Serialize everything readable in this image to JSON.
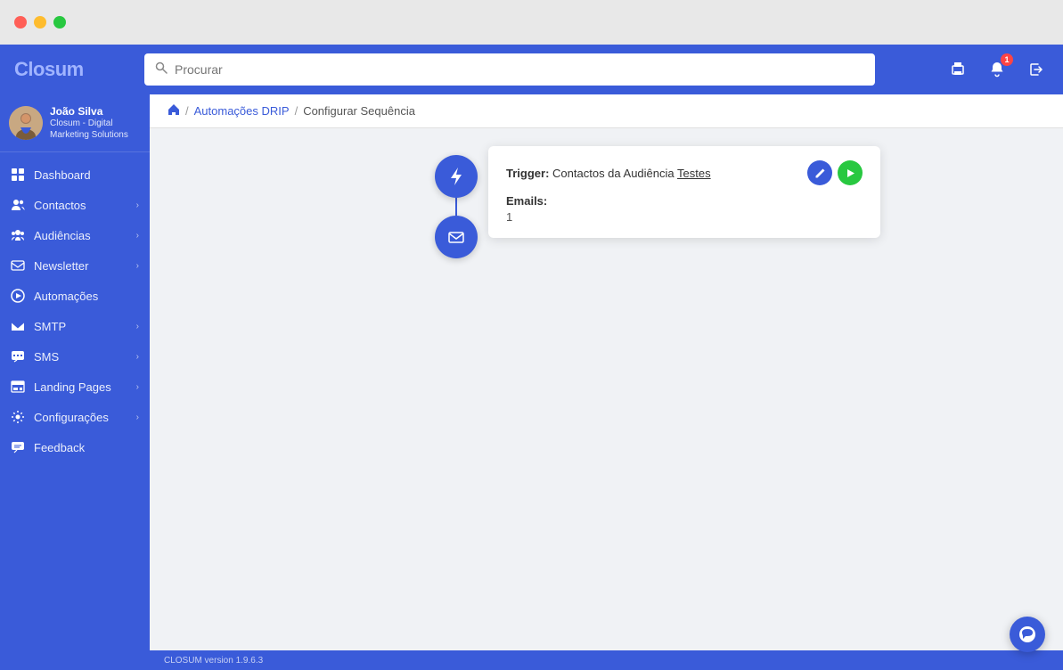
{
  "window": {
    "dots": [
      "red",
      "yellow",
      "green"
    ]
  },
  "topnav": {
    "logo_part1": "Cl",
    "logo_o": "o",
    "logo_part2": "sum",
    "search_placeholder": "Procurar",
    "notification_badge": "1"
  },
  "user": {
    "name": "João Silva",
    "company": "Closum - Digital Marketing Solutions"
  },
  "sidebar": {
    "items": [
      {
        "label": "Dashboard",
        "icon": "dashboard-icon",
        "has_chevron": false
      },
      {
        "label": "Contactos",
        "icon": "contacts-icon",
        "has_chevron": true
      },
      {
        "label": "Audiências",
        "icon": "audiences-icon",
        "has_chevron": true
      },
      {
        "label": "Newsletter",
        "icon": "newsletter-icon",
        "has_chevron": true
      },
      {
        "label": "Automações",
        "icon": "automacoes-icon",
        "has_chevron": false
      },
      {
        "label": "SMTP",
        "icon": "smtp-icon",
        "has_chevron": true
      },
      {
        "label": "SMS",
        "icon": "sms-icon",
        "has_chevron": true
      },
      {
        "label": "Landing Pages",
        "icon": "landing-pages-icon",
        "has_chevron": true
      },
      {
        "label": "Configurações",
        "icon": "config-icon",
        "has_chevron": true
      },
      {
        "label": "Feedback",
        "icon": "feedback-icon",
        "has_chevron": false
      }
    ]
  },
  "breadcrumb": {
    "home_icon": "home-icon",
    "link_label": "Automações DRIP",
    "separator": "/",
    "current": "Configurar Sequência"
  },
  "trigger_card": {
    "trigger_prefix": "Trigger:",
    "trigger_text": "Contactos da Audiência",
    "trigger_underline": "Testes",
    "emails_label": "Emails:",
    "emails_value": "1"
  },
  "footer": {
    "text": "CLOSUM version 1.9.6.3"
  }
}
